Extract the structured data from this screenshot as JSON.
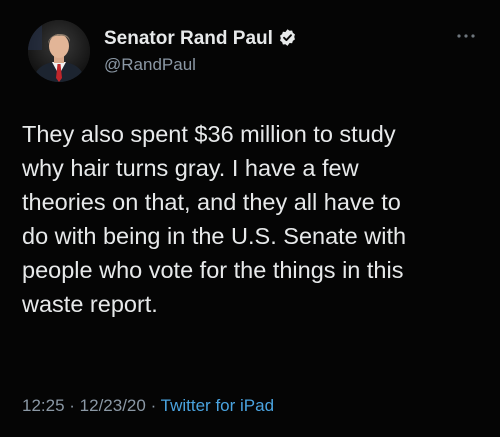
{
  "author": {
    "name": "Senator Rand Paul",
    "handle": "@RandPaul",
    "verified": true,
    "avatar_icon": "profile-photo-icon"
  },
  "tweet": {
    "text": "They also spent $36 million to study\nwhy hair turns gray. I have a few\ntheories on that, and they all have to\ndo with being in the U.S. Senate with\npeople who vote for the things in this\nwaste report."
  },
  "meta": {
    "time": "12:25",
    "separator": " · ",
    "date": "12/23/20",
    "source": "Twitter for iPad"
  },
  "colors": {
    "background": "#050505",
    "text": "#e7e9ea",
    "muted": "#8b98a5",
    "link": "#4aa3df"
  }
}
